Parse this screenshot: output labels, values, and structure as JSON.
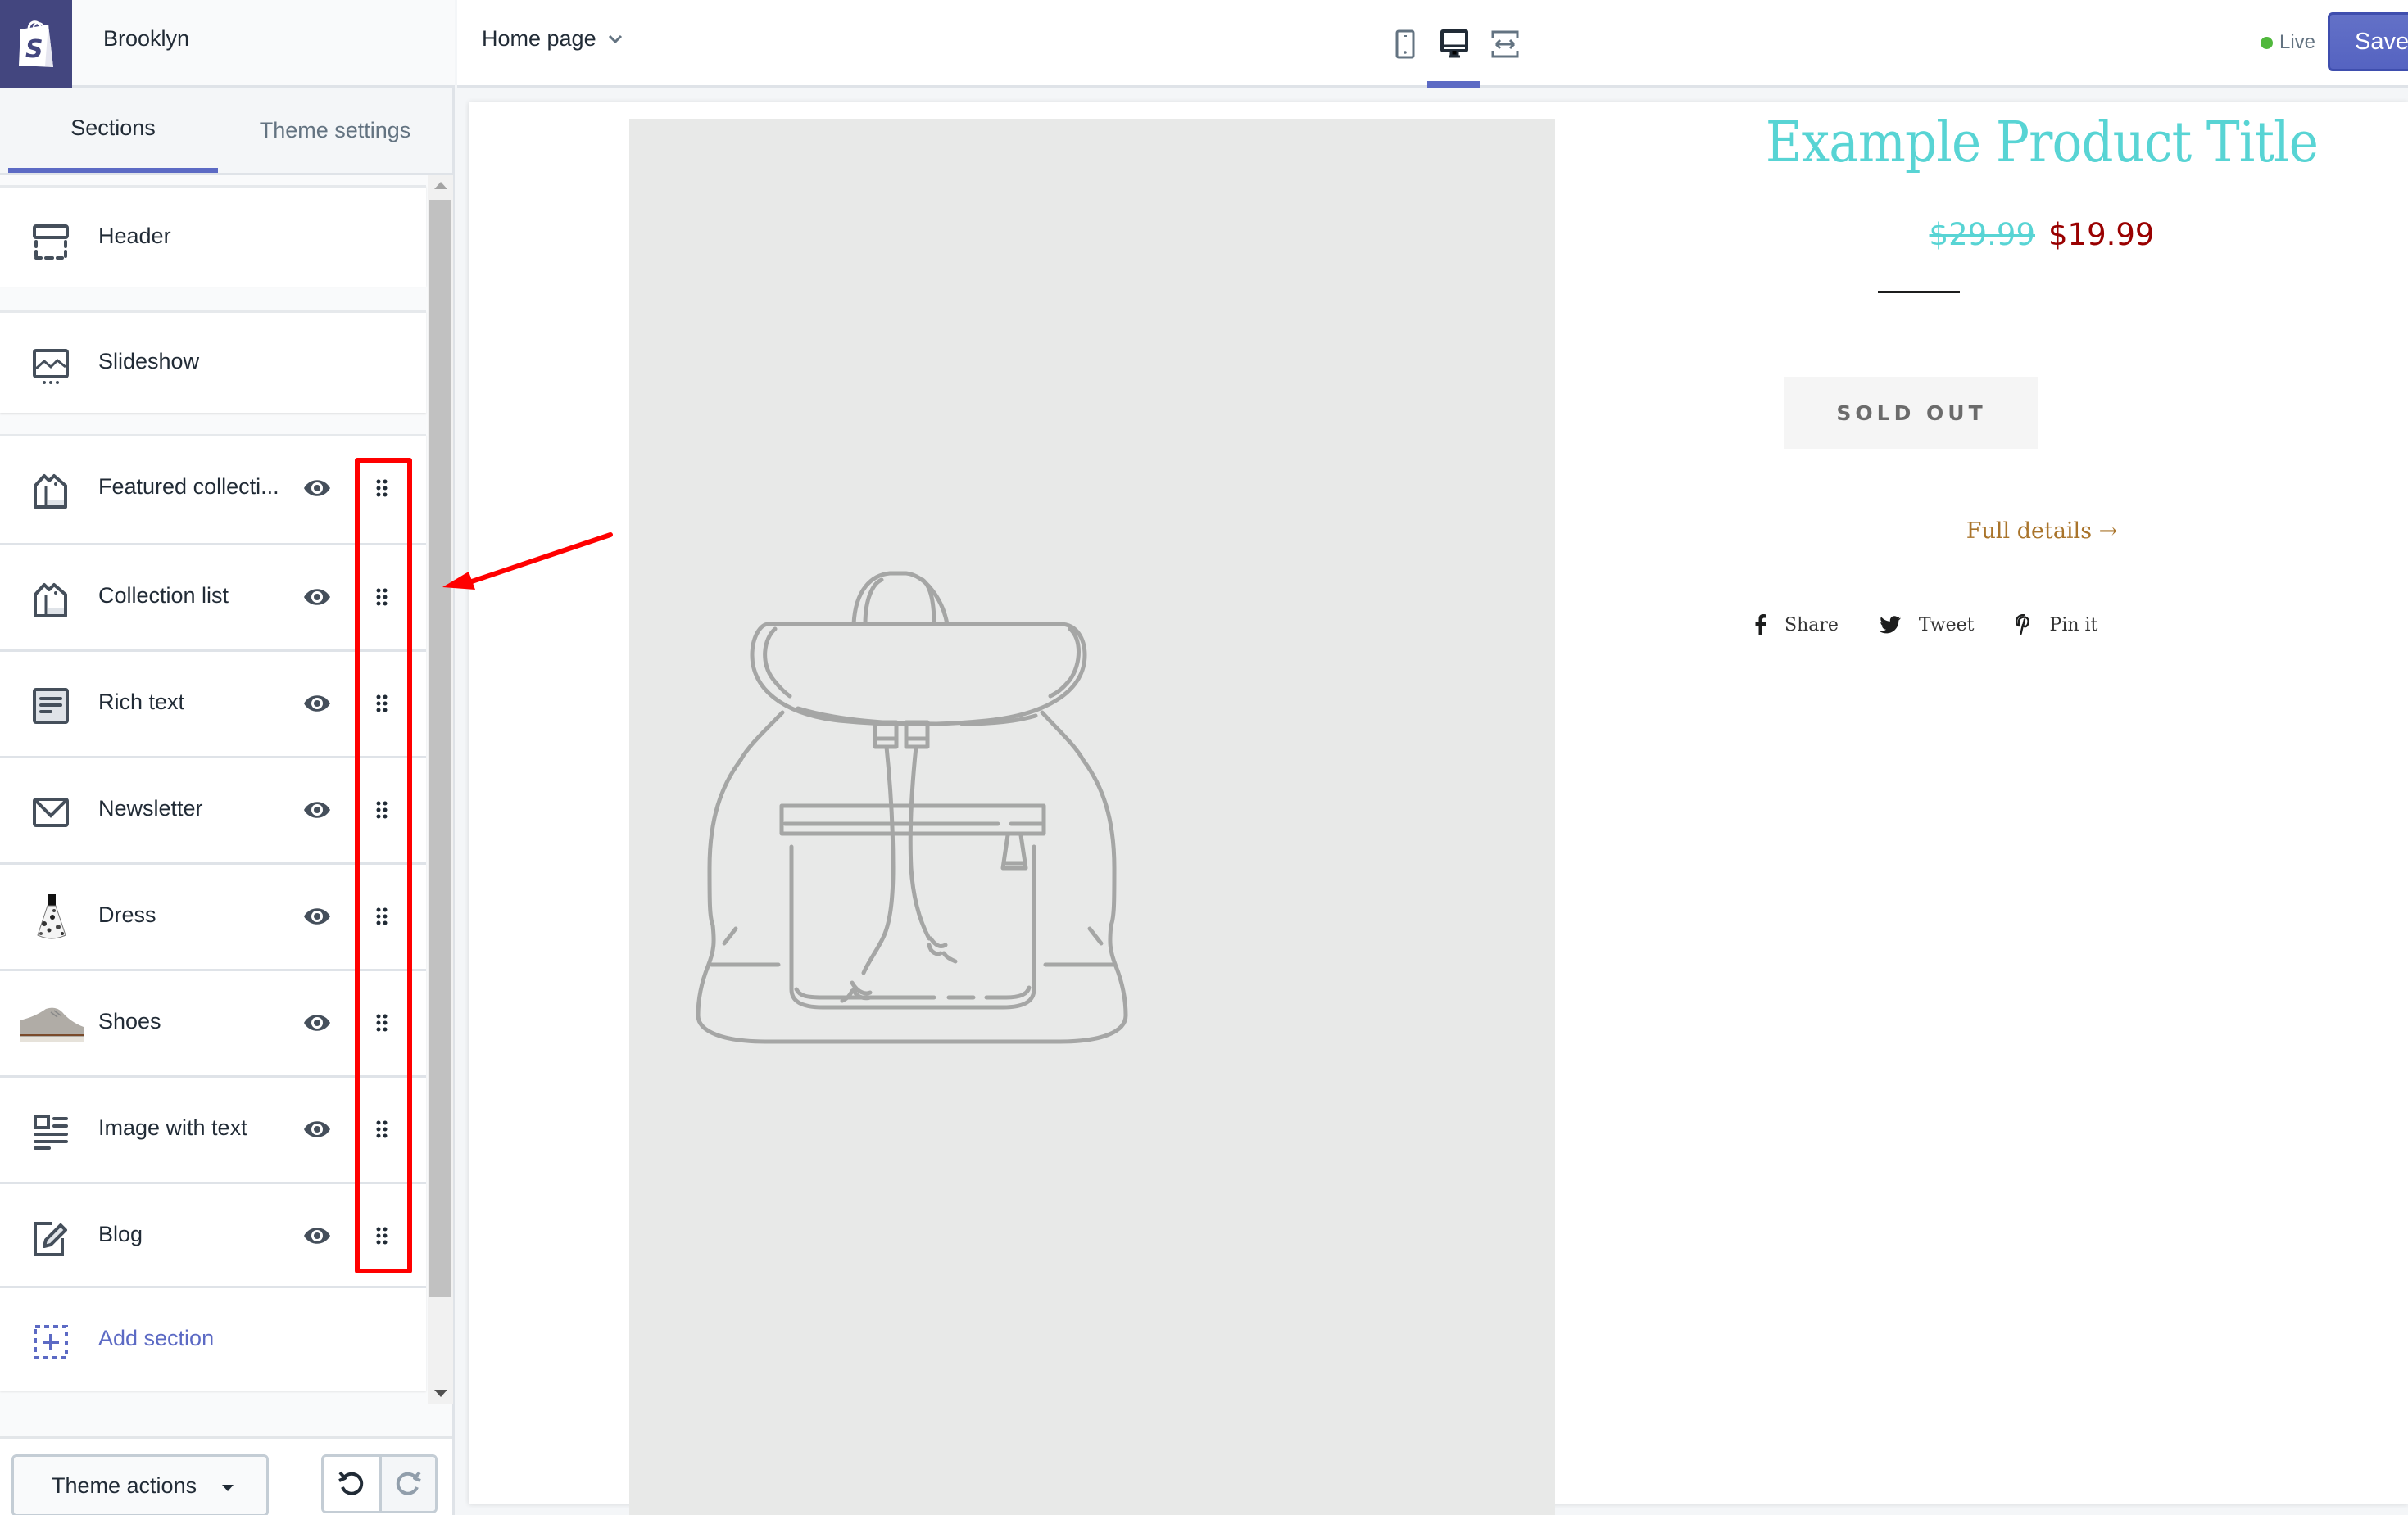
{
  "sidebar": {
    "store_name": "Brooklyn",
    "tabs": [
      {
        "label": "Sections",
        "active": true
      },
      {
        "label": "Theme settings",
        "active": false
      }
    ],
    "fixed_sections": [
      {
        "label": "Header",
        "icon": "header-icon"
      },
      {
        "label": "Slideshow",
        "icon": "slideshow-icon"
      }
    ],
    "sections": [
      {
        "label": "Featured collecti...",
        "icon": "collection-tag-icon",
        "visible": true
      },
      {
        "label": "Collection list",
        "icon": "collection-tag-icon",
        "visible": true
      },
      {
        "label": "Rich text",
        "icon": "rich-text-icon",
        "visible": true
      },
      {
        "label": "Newsletter",
        "icon": "envelope-icon",
        "visible": true
      },
      {
        "label": "Dress",
        "icon": "dress-thumbnail",
        "visible": true
      },
      {
        "label": "Shoes",
        "icon": "shoe-thumbnail",
        "visible": true
      },
      {
        "label": "Image with text",
        "icon": "image-with-text-icon",
        "visible": true
      },
      {
        "label": "Blog",
        "icon": "blog-edit-icon",
        "visible": true
      }
    ],
    "add_section_label": "Add section",
    "footer": {
      "theme_actions_label": "Theme actions"
    }
  },
  "toolbar": {
    "page_select_value": "Home page",
    "devices": [
      "mobile",
      "desktop",
      "fullscreen"
    ],
    "active_device": "desktop",
    "live_label": "Live",
    "save_label": "Save"
  },
  "preview": {
    "product_title": "Example Product Title",
    "compare_price": "$29.99",
    "price": "$19.99",
    "sold_out_label": "SOLD OUT",
    "full_details_label": "Full details →",
    "share": [
      {
        "label": "Share",
        "icon": "facebook-icon"
      },
      {
        "label": "Tweet",
        "icon": "twitter-icon"
      },
      {
        "label": "Pin it",
        "icon": "pinterest-icon"
      }
    ]
  },
  "colors": {
    "accent": "#5c6ac4",
    "logo_bg": "#43467f",
    "live": "#50b83c",
    "title": "#58d4d4",
    "sale_price": "#990000",
    "details_link": "#a9742b",
    "annotation": "#ff0000"
  }
}
